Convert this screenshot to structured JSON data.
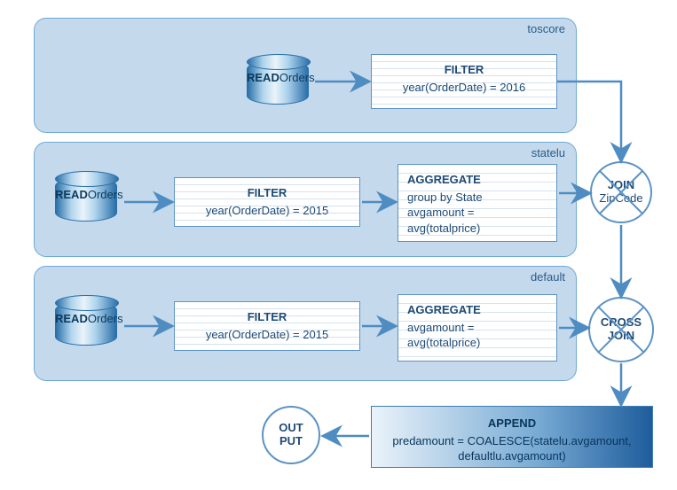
{
  "lanes": {
    "toscore": {
      "label": "toscore"
    },
    "statelu": {
      "label": "statelu"
    },
    "default": {
      "label": "default"
    }
  },
  "db": {
    "read": "READ",
    "source": "Orders"
  },
  "filter2016": {
    "title": "FILTER",
    "cond": "year(OrderDate) = 2016"
  },
  "filter2015": {
    "title": "FILTER",
    "cond": "year(OrderDate) = 2015"
  },
  "agg_state": {
    "title": "AGGREGATE",
    "l1": "group by State",
    "l2": "avgamount =",
    "l3": "avg(totalprice)"
  },
  "agg_default": {
    "title": "AGGREGATE",
    "l1": "avgamount =",
    "l2": "avg(totalprice)"
  },
  "join": {
    "title": "JOIN",
    "key": "ZipCode"
  },
  "crossjoin": {
    "l1": "CROSS",
    "l2": "JOIN"
  },
  "append": {
    "title": "APPEND",
    "l1": "predamount = COALESCE(statelu.avgamount,",
    "l2": "defaultlu.avgamount)"
  },
  "output": {
    "l1": "OUT",
    "l2": "PUT"
  }
}
